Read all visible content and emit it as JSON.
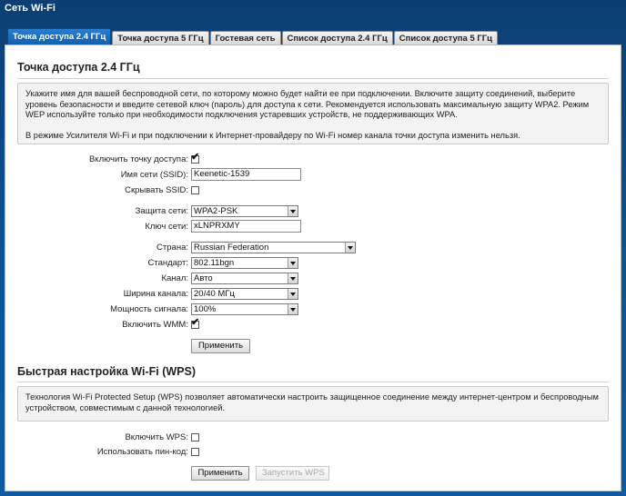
{
  "page_title": "Сеть Wi-Fi",
  "tabs": [
    {
      "label": "Точка доступа 2.4 ГГц",
      "active": true
    },
    {
      "label": "Точка доступа 5 ГГц",
      "active": false
    },
    {
      "label": "Гостевая сеть",
      "active": false
    },
    {
      "label": "Список доступа 2.4 ГГц",
      "active": false
    },
    {
      "label": "Список доступа 5 ГГц",
      "active": false
    }
  ],
  "ap": {
    "title": "Точка доступа 2.4 ГГц",
    "info_p1": "Укажите имя для вашей беспроводной сети, по которому можно будет найти ее при подключении. Включите защиту соединений, выберите уровень безопасности и введите сетевой ключ (пароль) для доступа к сети. Рекомендуется использовать максимальную защиту WPA2. Режим WEP используйте только при необходимости подключения устаревших устройств, не поддерживающих WPA.",
    "info_p2": "В режиме Усилителя Wi-Fi и при подключении к Интернет-провайдеру по Wi-Fi номер канала точки доступа изменить нельзя.",
    "enable_label": "Включить точку доступа:",
    "enable_checked": true,
    "ssid_label": "Имя сети (SSID):",
    "ssid_value": "Keenetic-1539",
    "hide_ssid_label": "Скрывать SSID:",
    "hide_ssid_checked": false,
    "security_label": "Защита сети:",
    "security_value": "WPA2-PSK",
    "key_label": "Ключ сети:",
    "key_value": "xLNPRXMY",
    "country_label": "Страна:",
    "country_value": "Russian Federation",
    "standard_label": "Стандарт:",
    "standard_value": "802.11bgn",
    "channel_label": "Канал:",
    "channel_value": "Авто",
    "width_label": "Ширина канала:",
    "width_value": "20/40 МГц",
    "power_label": "Мощность сигнала:",
    "power_value": "100%",
    "wmm_label": "Включить WMM:",
    "wmm_checked": true,
    "apply_label": "Применить"
  },
  "wps": {
    "title": "Быстрая настройка Wi-Fi (WPS)",
    "info": "Технология Wi-Fi Protected Setup (WPS) позволяет автоматически настроить защищенное соединение между интернет-центром и беспроводным устройством, совместимым с данной технологией.",
    "enable_label": "Включить WPS:",
    "enable_checked": false,
    "pin_label": "Использовать пин-код:",
    "pin_checked": false,
    "apply_label": "Применить",
    "start_label": "Запустить WPS"
  },
  "check_glyph": "✔"
}
